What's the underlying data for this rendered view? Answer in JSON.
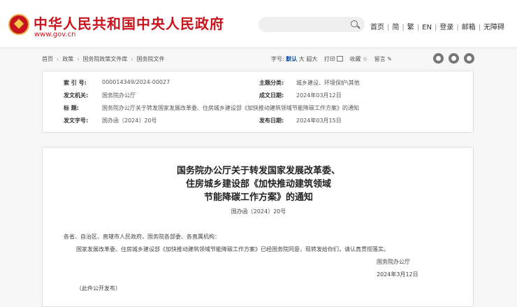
{
  "header": {
    "site_title": "中华人民共和国中央人民政府",
    "site_url": "www.gov.cn",
    "nav": [
      "首页",
      "简",
      "繁",
      "EN",
      "登录",
      "邮箱",
      "无障碍"
    ]
  },
  "breadcrumb": [
    "首页",
    "政策",
    "国务院政策文件库",
    "国务院文件"
  ],
  "toolbar": {
    "font_label": "字号:",
    "font_default": "默认",
    "font_large": "大",
    "font_xlarge": "超大",
    "print": "打印",
    "favorite": "收藏",
    "comment": "留言"
  },
  "meta": {
    "index_label": "索 引 号:",
    "index_value": "000014349/2024-00027",
    "topic_label": "主题分类:",
    "topic_value": "城乡建设、环境保护\\其他",
    "issuer_label": "发文机关:",
    "issuer_value": "国务院办公厅",
    "created_label": "成文日期:",
    "created_value": "2024年03月12日",
    "title_label": "标      题:",
    "title_value": "国务院办公厅关于转发国家发展改革委、住房城乡建设部《加快推动建筑领域节能降碳工作方案》的通知",
    "docno_label": "发文字号:",
    "docno_value": "国办函〔2024〕20号",
    "published_label": "发布日期:",
    "published_value": "2024年03月15日"
  },
  "article": {
    "title_line1": "国务院办公厅关于转发国家发展改革委、",
    "title_line2": "住房城乡建设部《加快推动建筑领域",
    "title_line3": "节能降碳工作方案》的通知",
    "doc_number": "国办函〔2024〕20号",
    "salutation": "各省、自治区、直辖市人民政府，国务院各部委、各直属机构：",
    "body": "国家发展改革委、住房城乡建设部《加快推动建筑领域节能降碳工作方案》已经国务院同意，现转发给你们，请认真贯彻落实。",
    "signature": "国务院办公厅",
    "sign_date": "2024年3月12日",
    "note": "（此件公开发布）"
  }
}
